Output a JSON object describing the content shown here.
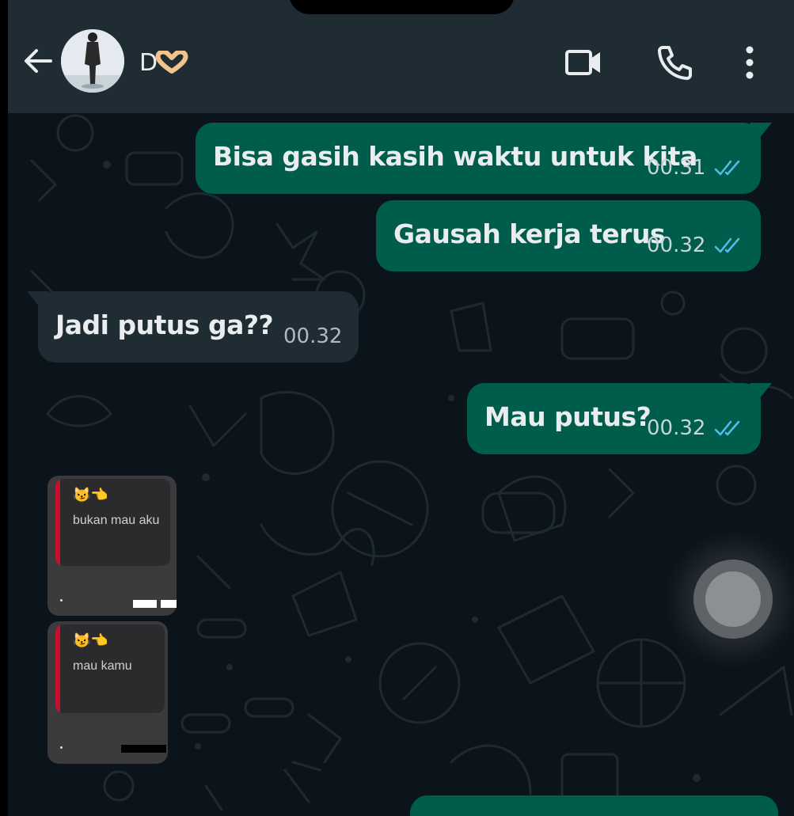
{
  "header": {
    "contact_name": "D",
    "contact_heart": "🫶"
  },
  "messages": [
    {
      "direction": "out",
      "text": "Bisa gasih kasih waktu untuk kita",
      "time": "00.31",
      "status": "read"
    },
    {
      "direction": "out",
      "text": "Gausah kerja terus",
      "time": "00.32",
      "status": "read"
    },
    {
      "direction": "in",
      "text": "Jadi putus ga??",
      "time": "00.32"
    },
    {
      "direction": "out",
      "text": "Mau putus?",
      "time": "00.32",
      "status": "read"
    }
  ],
  "stickers": [
    {
      "emoji": "😼👈",
      "text": "bukan mau aku"
    },
    {
      "emoji": "😼👈",
      "text": "mau kamu"
    }
  ],
  "colors": {
    "header_bg": "#1f2c34",
    "chat_bg": "#0b141a",
    "outgoing_bubble": "#005c4b",
    "incoming_bubble": "#1f2c34",
    "read_ticks": "#53bdeb"
  },
  "icons": [
    "back-arrow-icon",
    "video-call-icon",
    "phone-call-icon",
    "more-options-icon",
    "double-check-icon"
  ]
}
